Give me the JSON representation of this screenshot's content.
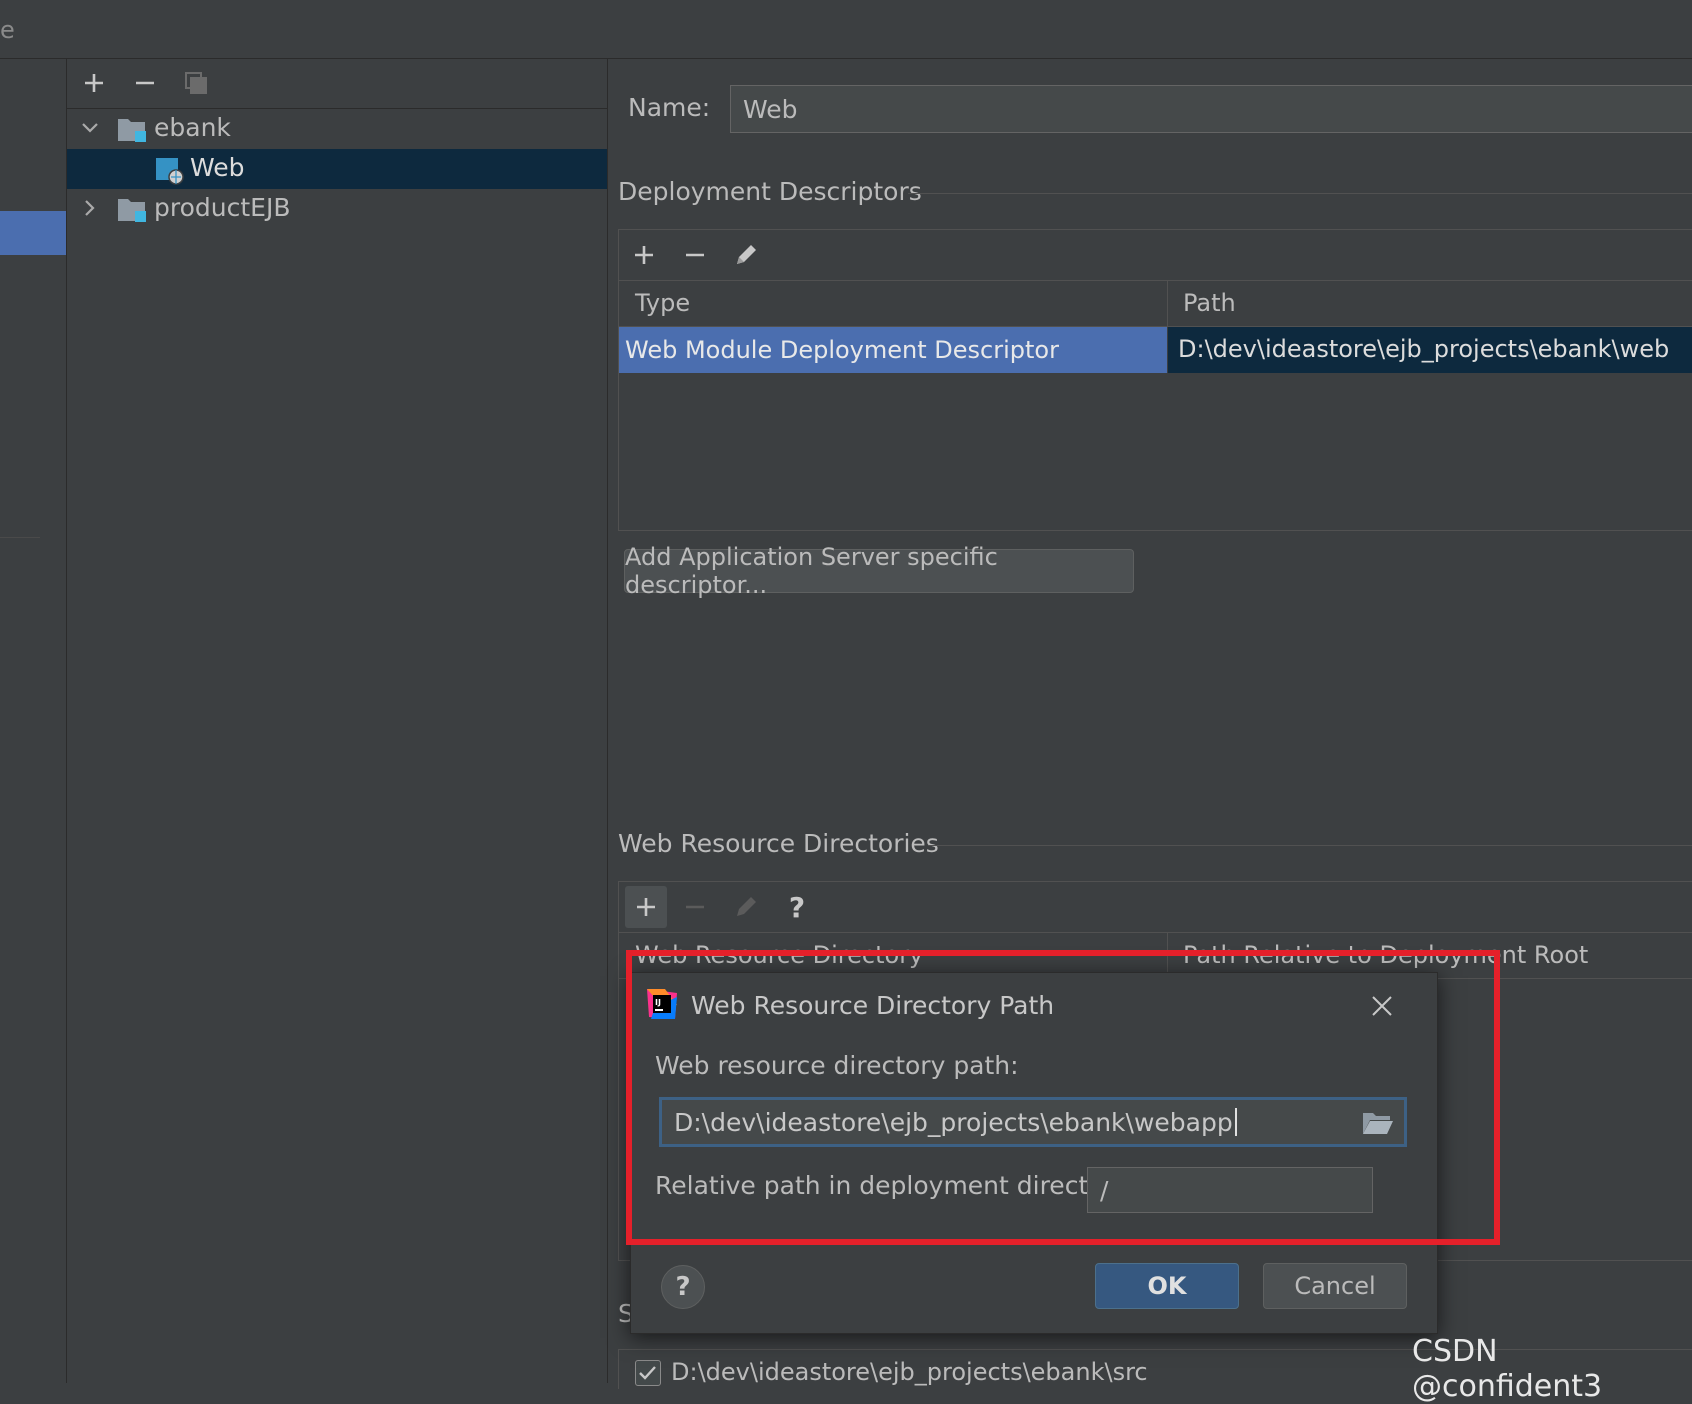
{
  "topbar": {
    "title_fragment": "e"
  },
  "tree": {
    "items": [
      {
        "label": "ebank",
        "expanded": true
      },
      {
        "label": "Web",
        "selected": true
      },
      {
        "label": "productEJB",
        "expanded": false
      }
    ]
  },
  "form": {
    "name_label": "Name:",
    "name_value": "Web"
  },
  "deployment_descriptors": {
    "title": "Deployment Descriptors",
    "columns": [
      "Type",
      "Path"
    ],
    "rows": [
      {
        "type": "Web Module Deployment Descriptor",
        "path": "D:\\dev\\ideastore\\ejb_projects\\ebank\\web"
      }
    ],
    "add_server_button": "Add Application Server specific descriptor..."
  },
  "web_resource_directories": {
    "title": "Web Resource Directories",
    "columns": [
      "Web Resource Directory",
      "Path Relative to Deployment Root"
    ]
  },
  "source_roots": {
    "title_fragment": "S",
    "row_path": "D:\\dev\\ideastore\\ejb_projects\\ebank\\src"
  },
  "dialog": {
    "title": "Web Resource Directory Path",
    "path_label": "Web resource directory path:",
    "path_value": "D:\\dev\\ideastore\\ejb_projects\\ebank\\webapp",
    "relative_label": "Relative path in deployment directory:",
    "relative_value": "/",
    "ok_label": "OK",
    "cancel_label": "Cancel",
    "help_label": "?"
  },
  "watermark": "CSDN @confident3",
  "colors": {
    "background": "#3c3f41",
    "selection": "#4b6eaf",
    "tree_selection": "#0d293e",
    "highlight_frame": "#e5202a",
    "ok_button": "#365880"
  }
}
